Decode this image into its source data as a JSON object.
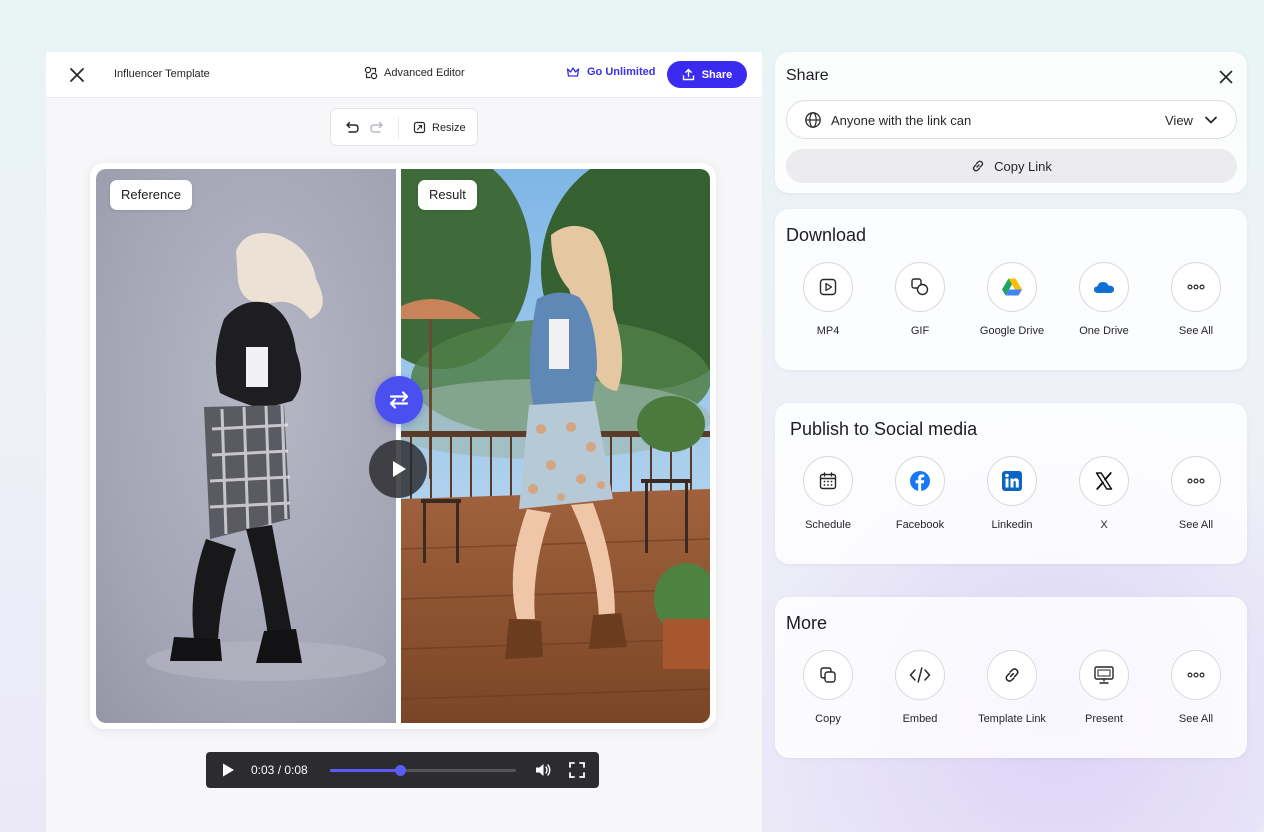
{
  "editor": {
    "template_name": "Influencer Template",
    "advanced_editor_label": "Advanced Editor",
    "go_unlimited_label": "Go Unlimited",
    "share_label": "Share",
    "resize_label": "Resize"
  },
  "preview": {
    "reference_label": "Reference",
    "result_label": "Result"
  },
  "player": {
    "time_display": "0:03 / 0:08",
    "progress": 0.375
  },
  "share_panel": {
    "title": "Share",
    "permission_label": "Anyone with the link can",
    "permission_value": "View",
    "copy_link_label": "Copy Link"
  },
  "download": {
    "title": "Download",
    "options": [
      {
        "label": "MP4",
        "icon": "video-file-icon"
      },
      {
        "label": "GIF",
        "icon": "gif-shapes-icon"
      },
      {
        "label": "Google Drive",
        "icon": "google-drive-icon"
      },
      {
        "label": "One Drive",
        "icon": "onedrive-icon"
      },
      {
        "label": "See All",
        "icon": "more-dots-icon"
      }
    ]
  },
  "social": {
    "title": "Publish to Social media",
    "options": [
      {
        "label": "Schedule",
        "icon": "calendar-icon"
      },
      {
        "label": "Facebook",
        "icon": "facebook-icon"
      },
      {
        "label": "Linkedin",
        "icon": "linkedin-icon"
      },
      {
        "label": "X",
        "icon": "x-logo-icon"
      },
      {
        "label": "See All",
        "icon": "more-dots-icon"
      }
    ]
  },
  "more": {
    "title": "More",
    "options": [
      {
        "label": "Copy",
        "icon": "copy-icon"
      },
      {
        "label": "Embed",
        "icon": "code-icon"
      },
      {
        "label": "Template Link",
        "icon": "link-icon"
      },
      {
        "label": "Present",
        "icon": "presentation-icon"
      },
      {
        "label": "See All",
        "icon": "more-dots-icon"
      }
    ]
  },
  "colors": {
    "accent": "#3b2bf0",
    "swap_button": "#4a4ff0",
    "player_bg": "#2b2b30",
    "progress": "#5b5cf6",
    "facebook": "#1877f2",
    "linkedin": "#0a66c2",
    "onedrive": "#0f6fd6"
  }
}
